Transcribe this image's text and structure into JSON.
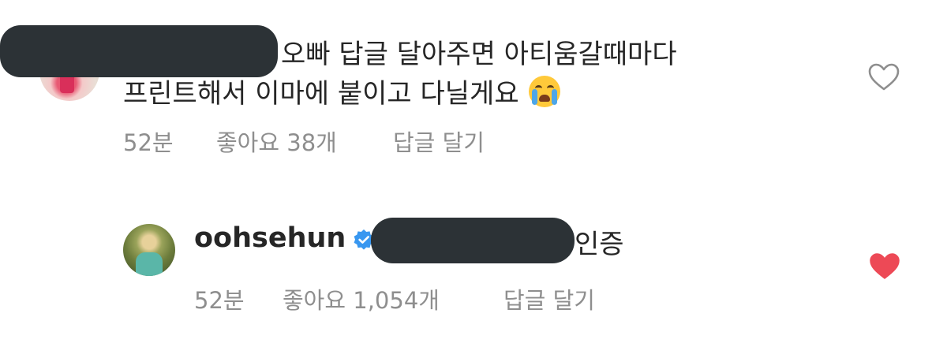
{
  "comments": [
    {
      "line1": "오빠 답글 달아주면 아티움갈때마다",
      "line2": "프린트해서 이마에 붙이고 다닐게요",
      "emoji": "loudly-crying-face",
      "time": "52분",
      "likes": "좋아요 38개",
      "reply": "답글 달기",
      "liked": false
    },
    {
      "username": "oohsehun",
      "verified": true,
      "text": "인증",
      "time": "52분",
      "likes": "좋아요 1,054개",
      "reply": "답글 달기",
      "liked": true
    }
  ],
  "colors": {
    "text": "#262626",
    "meta": "#8e8e8e",
    "heart_liked": "#ed4956",
    "verified": "#3897f0",
    "redaction": "#2c3236"
  }
}
